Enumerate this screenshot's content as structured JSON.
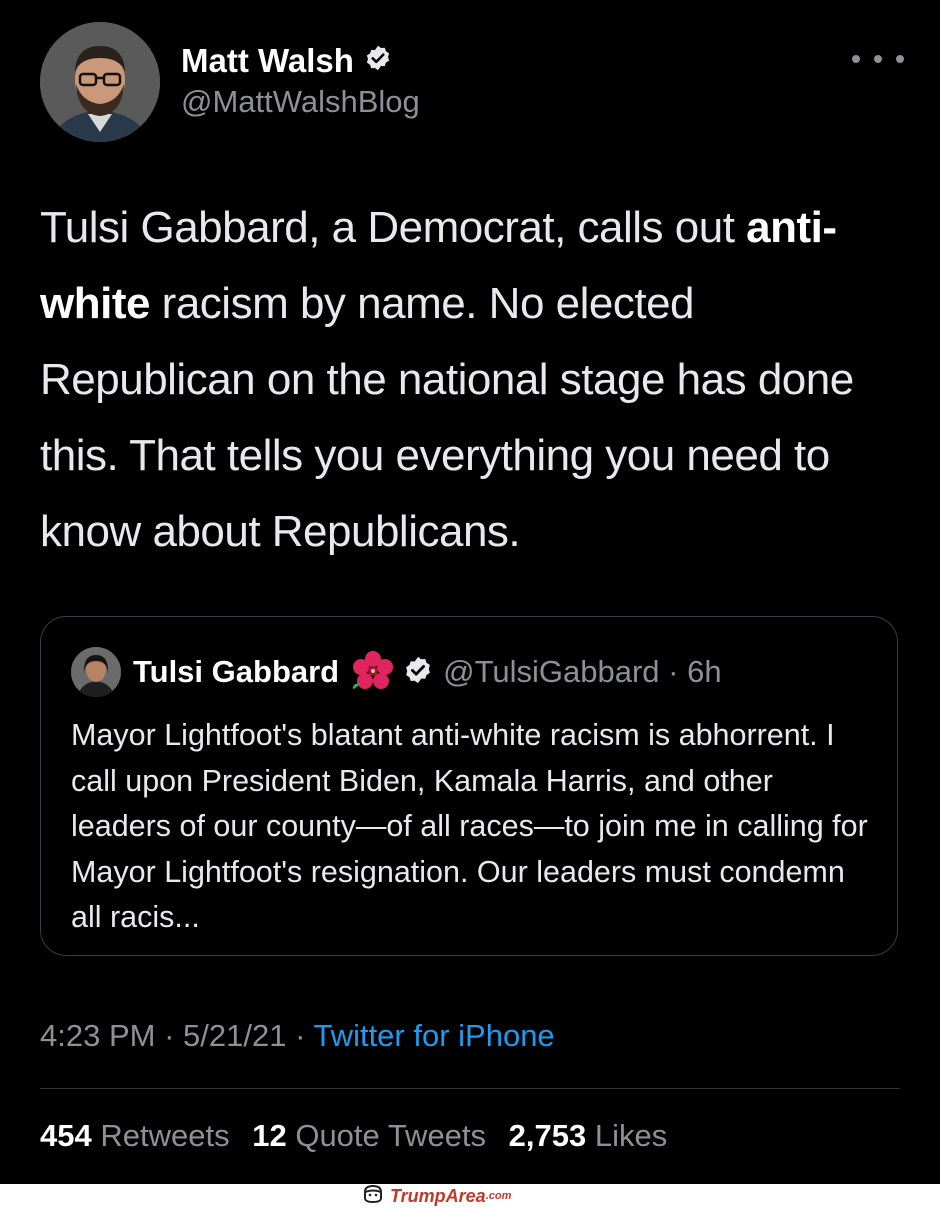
{
  "tweet": {
    "author": {
      "name": "Matt Walsh",
      "handle": "@MattWalshBlog",
      "verified": true
    },
    "text": {
      "part1": "Tulsi Gabbard, a Democrat, calls out ",
      "bold": "anti-white",
      "part2": " racism by name. No elected Republican on the national stage has done this. That tells you everything you need to know about Republicans."
    },
    "quoted": {
      "name": "Tulsi Gabbard",
      "handle_time": "@TulsiGabbard · 6h",
      "verified": true,
      "emoji": "hibiscus-flower",
      "text": "Mayor Lightfoot's blatant anti-white racism is abhorrent. I call upon President Biden, Kamala Harris, and other leaders of our county—of all races—to join me in calling for Mayor Lightfoot's resignation. Our leaders must condemn all racis..."
    },
    "meta": {
      "time": "4:23 PM",
      "sep1": " · ",
      "date": "5/21/21",
      "sep2": " · ",
      "source": "Twitter for iPhone"
    },
    "stats": {
      "retweets_count": "454",
      "retweets_label": "Retweets",
      "quotes_count": "12",
      "quotes_label": "Quote Tweets",
      "likes_count": "2,753",
      "likes_label": "Likes"
    }
  },
  "watermark": {
    "name": "TrumpArea",
    "tld": ".com"
  },
  "colors": {
    "background": "#000000",
    "text": "#e7e9ea",
    "secondary": "#8b9197",
    "link": "#1d9bf0",
    "watermark": "#c0392b"
  }
}
